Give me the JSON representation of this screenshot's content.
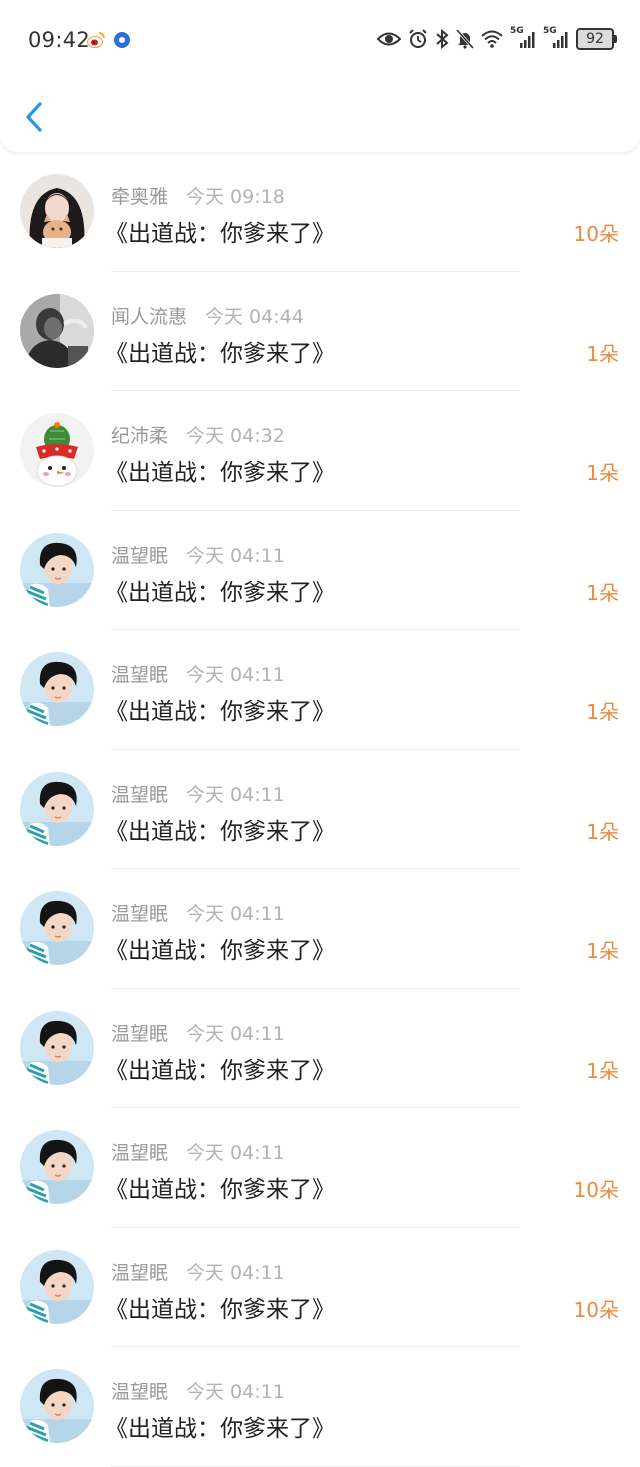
{
  "status_bar": {
    "time": "09:42",
    "battery": "92",
    "signal_1_label": "5G",
    "signal_2_label": "5G"
  },
  "colors": {
    "accent": "#2196e8",
    "gift_count": "#ef8a3c",
    "name_text": "#9a9a9a",
    "time_text": "#b3b3b3",
    "title_text": "#222222"
  },
  "list": [
    {
      "name": "牵奥雅",
      "time": "今天 09:18",
      "title": "《出道战：你爹来了》",
      "count": "10朵",
      "avatar": "girl-with-cat"
    },
    {
      "name": "闻人流惠",
      "time": "今天 04:44",
      "title": "《出道战：你爹来了》",
      "count": "1朵",
      "avatar": "grayscale-man"
    },
    {
      "name": "纪沛柔",
      "time": "今天 04:32",
      "title": "《出道战：你爹来了》",
      "count": "1朵",
      "avatar": "cactus-snowman"
    },
    {
      "name": "温望眠",
      "time": "今天 04:11",
      "title": "《出道战：你爹来了》",
      "count": "1朵",
      "avatar": "boy-portrait"
    },
    {
      "name": "温望眠",
      "time": "今天 04:11",
      "title": "《出道战：你爹来了》",
      "count": "1朵",
      "avatar": "boy-portrait"
    },
    {
      "name": "温望眠",
      "time": "今天 04:11",
      "title": "《出道战：你爹来了》",
      "count": "1朵",
      "avatar": "boy-portrait"
    },
    {
      "name": "温望眠",
      "time": "今天 04:11",
      "title": "《出道战：你爹来了》",
      "count": "1朵",
      "avatar": "boy-portrait"
    },
    {
      "name": "温望眠",
      "time": "今天 04:11",
      "title": "《出道战：你爹来了》",
      "count": "1朵",
      "avatar": "boy-portrait"
    },
    {
      "name": "温望眠",
      "time": "今天 04:11",
      "title": "《出道战：你爹来了》",
      "count": "10朵",
      "avatar": "boy-portrait"
    },
    {
      "name": "温望眠",
      "time": "今天 04:11",
      "title": "《出道战：你爹来了》",
      "count": "10朵",
      "avatar": "boy-portrait"
    },
    {
      "name": "温望眠",
      "time": "今天 04:11",
      "title": "《出道战：你爹来了》",
      "count": "",
      "avatar": "boy-portrait"
    }
  ]
}
